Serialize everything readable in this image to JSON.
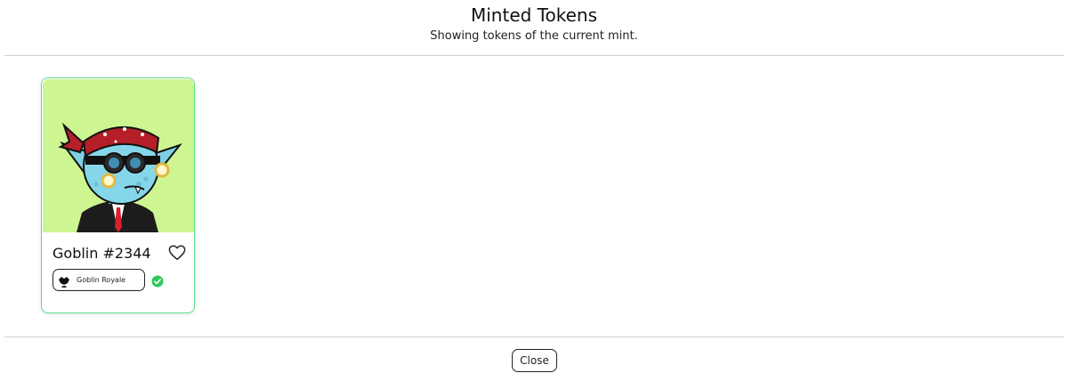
{
  "header": {
    "title": "Minted Tokens",
    "subtitle": "Showing tokens of the current mint."
  },
  "tokens": [
    {
      "name": "Goblin #2344",
      "collection": "Goblin Royale",
      "verified": true,
      "image_background": "#cdf591",
      "favorite_icon": "heart-outline-icon"
    }
  ],
  "footer": {
    "close_label": "Close"
  },
  "colors": {
    "card_border": "#5ee08a",
    "verified_badge": "#2fc95b",
    "divider": "#cfcfcf"
  }
}
